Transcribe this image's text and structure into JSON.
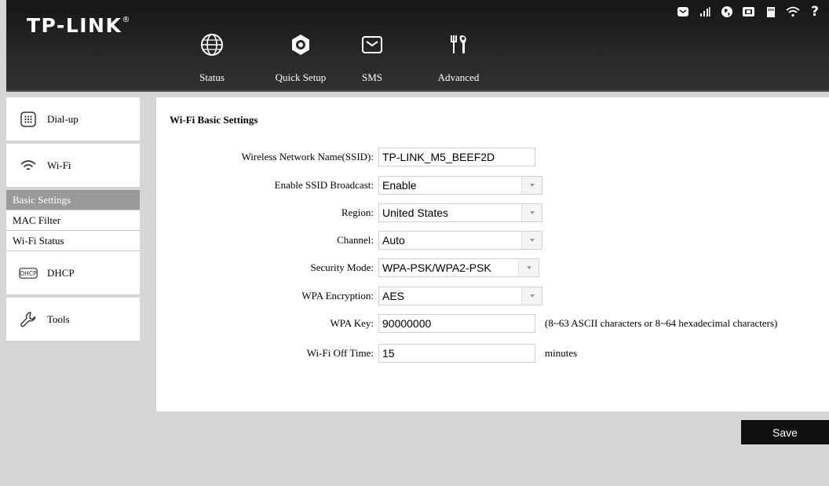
{
  "brand": {
    "logo": "TP-LINK",
    "mark": "®"
  },
  "nav": {
    "status": "Status",
    "quick_setup": "Quick Setup",
    "sms": "SMS",
    "advanced": "Advanced"
  },
  "status_icons": [
    "sms-icon",
    "signal-icon",
    "internet-icon",
    "battery-icon",
    "sd-card-icon",
    "wifi-icon"
  ],
  "help_label": "?",
  "sidebar": {
    "dialup": "Dial-up",
    "wifi": "Wi-Fi",
    "wifi_sub": [
      "Basic Settings",
      "MAC Filter",
      "Wi-Fi Status"
    ],
    "dhcp": "DHCP",
    "dhcp_badge": "DHCP",
    "tools": "Tools"
  },
  "panel": {
    "title": "Wi-Fi Basic Settings",
    "fields": {
      "ssid": {
        "label": "Wireless Network Name(SSID):",
        "value": "TP-LINK_M5_BEEF2D"
      },
      "broadcast": {
        "label": "Enable SSID Broadcast:",
        "value": "Enable"
      },
      "region": {
        "label": "Region:",
        "value": "United States"
      },
      "channel": {
        "label": "Channel:",
        "value": "Auto"
      },
      "security": {
        "label": "Security Mode:",
        "value": "WPA-PSK/WPA2-PSK"
      },
      "encryption": {
        "label": "WPA Encryption:",
        "value": "AES"
      },
      "key": {
        "label": "WPA Key:",
        "value": "90000000",
        "hint": "(8~63 ASCII characters or 8~64 hexadecimal characters)"
      },
      "offtime": {
        "label": "Wi-Fi Off Time:",
        "value": "15",
        "unit": "minutes"
      }
    }
  },
  "save_label": "Save"
}
